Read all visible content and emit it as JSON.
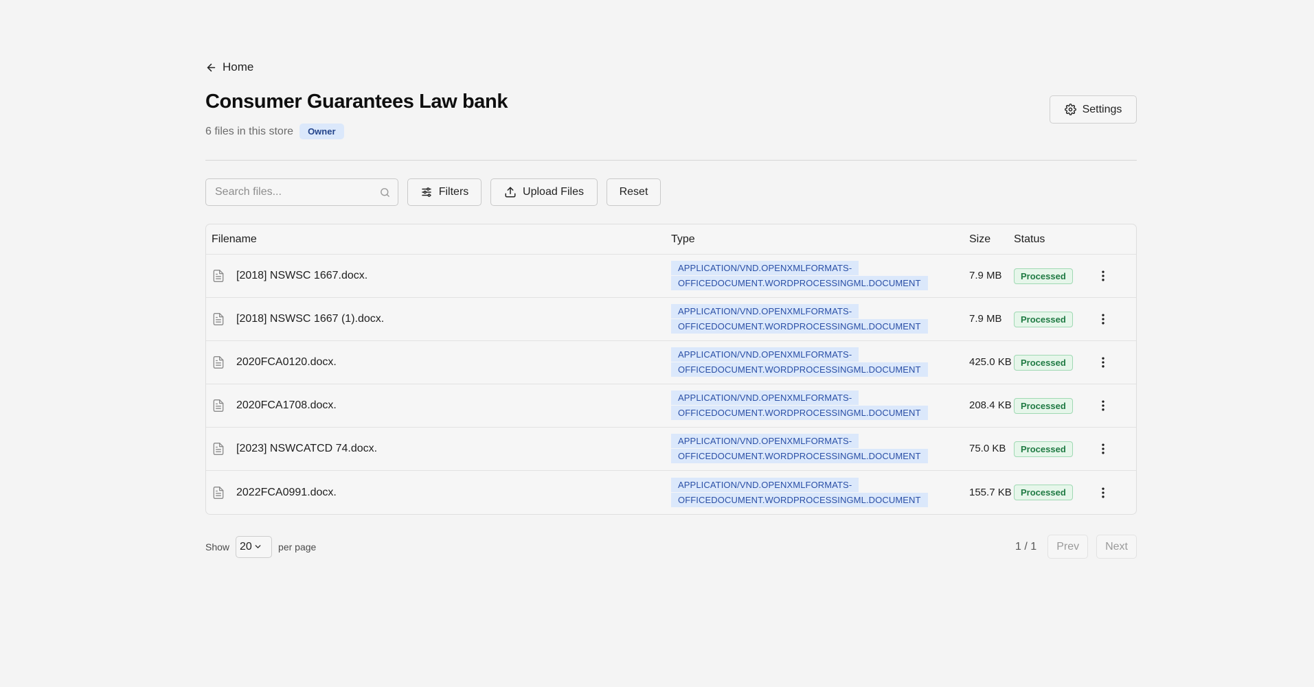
{
  "nav": {
    "back_label": "Home"
  },
  "header": {
    "title": "Consumer Guarantees Law bank",
    "subtitle": "6 files in this store",
    "role_badge": "Owner",
    "settings_label": "Settings"
  },
  "toolbar": {
    "search_placeholder": "Search files...",
    "search_value": "",
    "filters_label": "Filters",
    "upload_label": "Upload Files",
    "reset_label": "Reset"
  },
  "table": {
    "columns": {
      "filename": "Filename",
      "type": "Type",
      "size": "Size",
      "status": "Status"
    },
    "rows": [
      {
        "filename": "[2018] NSWSC 1667.docx.",
        "type": "APPLICATION/VND.OPENXMLFORMATS-OFFICEDOCUMENT.WORDPROCESSINGML.DOCUMENT",
        "size": "7.9 MB",
        "status": "Processed"
      },
      {
        "filename": "[2018] NSWSC 1667 (1).docx.",
        "type": "APPLICATION/VND.OPENXMLFORMATS-OFFICEDOCUMENT.WORDPROCESSINGML.DOCUMENT",
        "size": "7.9 MB",
        "status": "Processed"
      },
      {
        "filename": "2020FCA0120.docx.",
        "type": "APPLICATION/VND.OPENXMLFORMATS-OFFICEDOCUMENT.WORDPROCESSINGML.DOCUMENT",
        "size": "425.0 KB",
        "status": "Processed"
      },
      {
        "filename": "2020FCA1708.docx.",
        "type": "APPLICATION/VND.OPENXMLFORMATS-OFFICEDOCUMENT.WORDPROCESSINGML.DOCUMENT",
        "size": "208.4 KB",
        "status": "Processed"
      },
      {
        "filename": "[2023] NSWCATCD 74.docx.",
        "type": "APPLICATION/VND.OPENXMLFORMATS-OFFICEDOCUMENT.WORDPROCESSINGML.DOCUMENT",
        "size": "75.0 KB",
        "status": "Processed"
      },
      {
        "filename": "2022FCA0991.docx.",
        "type": "APPLICATION/VND.OPENXMLFORMATS-OFFICEDOCUMENT.WORDPROCESSINGML.DOCUMENT",
        "size": "155.7 KB",
        "status": "Processed"
      }
    ]
  },
  "footer": {
    "show_label": "Show",
    "per_page_value": "20",
    "per_page_label": "per page",
    "page_indicator": "1 / 1",
    "prev_label": "Prev",
    "next_label": "Next"
  },
  "colors": {
    "background": "#f4f4f4",
    "badge_blue_bg": "#dbe8fb",
    "badge_blue_text": "#23448b",
    "status_green_bg": "#e6f6ea",
    "status_green_text": "#1f7a43"
  },
  "icons": {
    "back": "arrow-left-icon",
    "settings": "gear-icon",
    "search": "search-icon",
    "filters": "sliders-icon",
    "upload": "upload-icon",
    "file": "document-icon",
    "row_menu": "more-vertical-icon",
    "select": "chevron-down-icon"
  }
}
